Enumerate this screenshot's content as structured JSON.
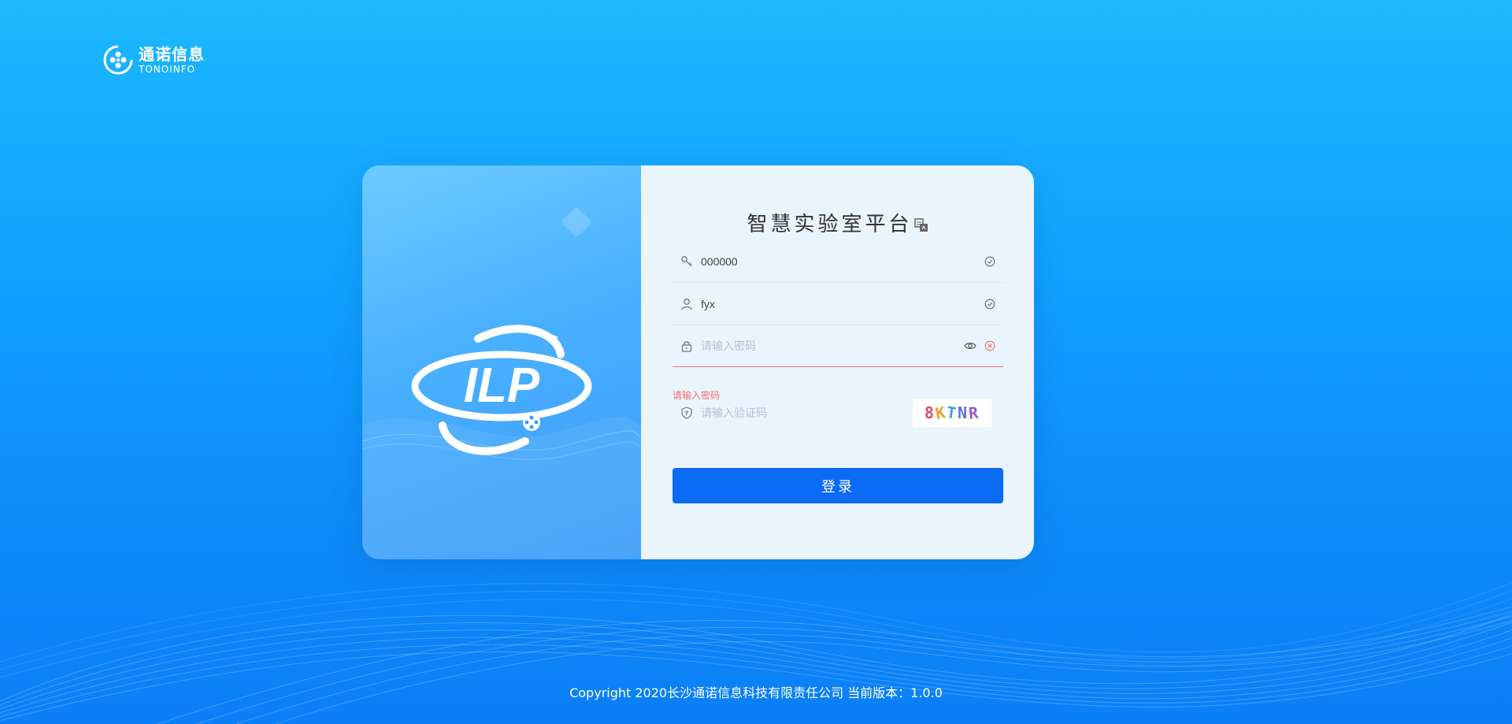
{
  "brand": {
    "name_cn": "通诺信息",
    "name_en": "TONOINFO"
  },
  "logo": {
    "text": "ILP"
  },
  "form": {
    "title": "智慧实验室平台",
    "lab_code": {
      "value": "000000",
      "icon": "key-icon"
    },
    "username": {
      "value": "fyx",
      "icon": "user-icon"
    },
    "password": {
      "placeholder": "请输入密码",
      "value": "",
      "icon": "lock-icon",
      "error": "请输入密码"
    },
    "captcha": {
      "placeholder": "请输入验证码",
      "value": "",
      "icon": "shield-icon",
      "image_text": [
        "8",
        "K",
        "T",
        "N",
        "R"
      ]
    },
    "login_label": "登录"
  },
  "footer": {
    "text": "Copyright 2020长沙通诺信息科技有限责任公司 当前版本：1.0.0"
  },
  "colors": {
    "accent": "#0c6bf5",
    "error": "#f56c6c",
    "bg_top": "#1db8ff",
    "bg_bottom": "#0b7ff6"
  }
}
